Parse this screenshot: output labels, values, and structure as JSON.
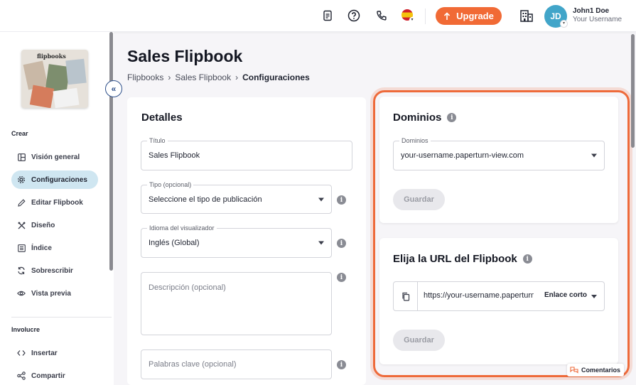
{
  "topbar": {
    "icons": [
      "document-icon",
      "help-icon",
      "phone-icon",
      "spain-flag-icon",
      "building-icon"
    ],
    "upgrade_label": "Upgrade",
    "avatar_initials": "JD",
    "user_name": "John1 Doe",
    "user_handle": "Your Username"
  },
  "sidebar": {
    "thumbnail_logo": "flipbooks",
    "section_create": "Crear",
    "items_create": [
      {
        "label": "Visión general",
        "icon": "layout-icon",
        "active": false
      },
      {
        "label": "Configuraciones",
        "icon": "gear-icon",
        "active": true
      },
      {
        "label": "Editar Flipbook",
        "icon": "pencil-icon",
        "active": false
      },
      {
        "label": "Diseño",
        "icon": "design-icon",
        "active": false
      },
      {
        "label": "Índice",
        "icon": "list-icon",
        "active": false
      },
      {
        "label": "Sobrescribir",
        "icon": "refresh-icon",
        "active": false
      },
      {
        "label": "Vista previa",
        "icon": "eye-icon",
        "active": false
      }
    ],
    "section_involve": "Involucre",
    "items_involve": [
      {
        "label": "Insertar",
        "icon": "code-icon"
      },
      {
        "label": "Compartir",
        "icon": "share-icon"
      }
    ]
  },
  "main": {
    "title": "Sales Flipbook",
    "breadcrumb": [
      "Flipbooks",
      "Sales Flipbook",
      "Configuraciones"
    ],
    "details": {
      "heading": "Detalles",
      "title_label": "Título",
      "title_value": "Sales Flipbook",
      "type_label": "Tipo (opcional)",
      "type_value": "Seleccione el tipo de publicación",
      "language_label": "Idioma del visualizador",
      "language_value": "Inglés (Global)",
      "description_placeholder": "Descripción (opcional)",
      "keywords_placeholder": "Palabras clave (opcional)"
    },
    "domains": {
      "heading": "Dominios",
      "field_label": "Dominios",
      "field_value": "your-username.paperturn-view.com",
      "save_label": "Guardar"
    },
    "url": {
      "heading": "Elija la URL del Flipbook",
      "url_value": "https://your-username.paperturn",
      "short_link_label": "Enlace corto",
      "save_label": "Guardar"
    }
  },
  "comments_label": "Comentarios",
  "colors": {
    "accent": "#f16a35",
    "highlight_border": "#ee6a3a",
    "active_nav": "#cfe6f1",
    "avatar": "#41a5c9"
  }
}
